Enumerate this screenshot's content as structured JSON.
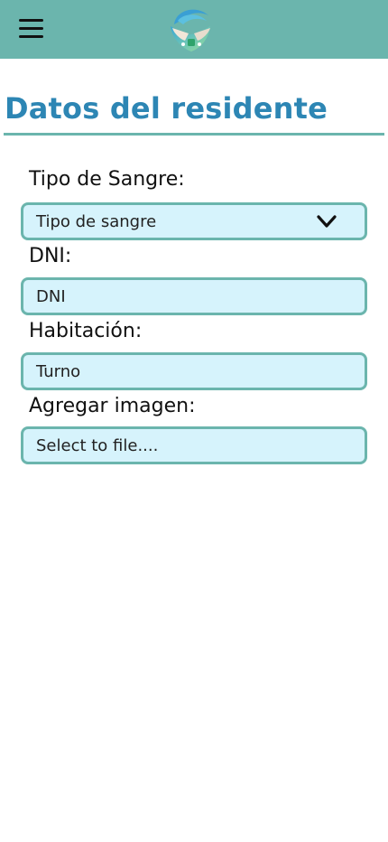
{
  "header": {
    "menu_icon": "hamburger-menu-icon",
    "logo_icon": "care-hands-logo-icon",
    "background": "#6bb5ad"
  },
  "page": {
    "title": "Datos del residente",
    "title_color": "#2d86b4"
  },
  "form": {
    "blood_type": {
      "label": "Tipo de Sangre:",
      "selected": "Tipo de sangre",
      "icon": "chevron-down-icon"
    },
    "dni": {
      "label": "DNI:",
      "placeholder": "DNI"
    },
    "room": {
      "label": "Habitación:",
      "placeholder": "Turno"
    },
    "image": {
      "label": "Agregar imagen:",
      "placeholder": "Select to file...."
    },
    "field_background": "#d6f3fc",
    "field_border": "#6bb5ad"
  }
}
